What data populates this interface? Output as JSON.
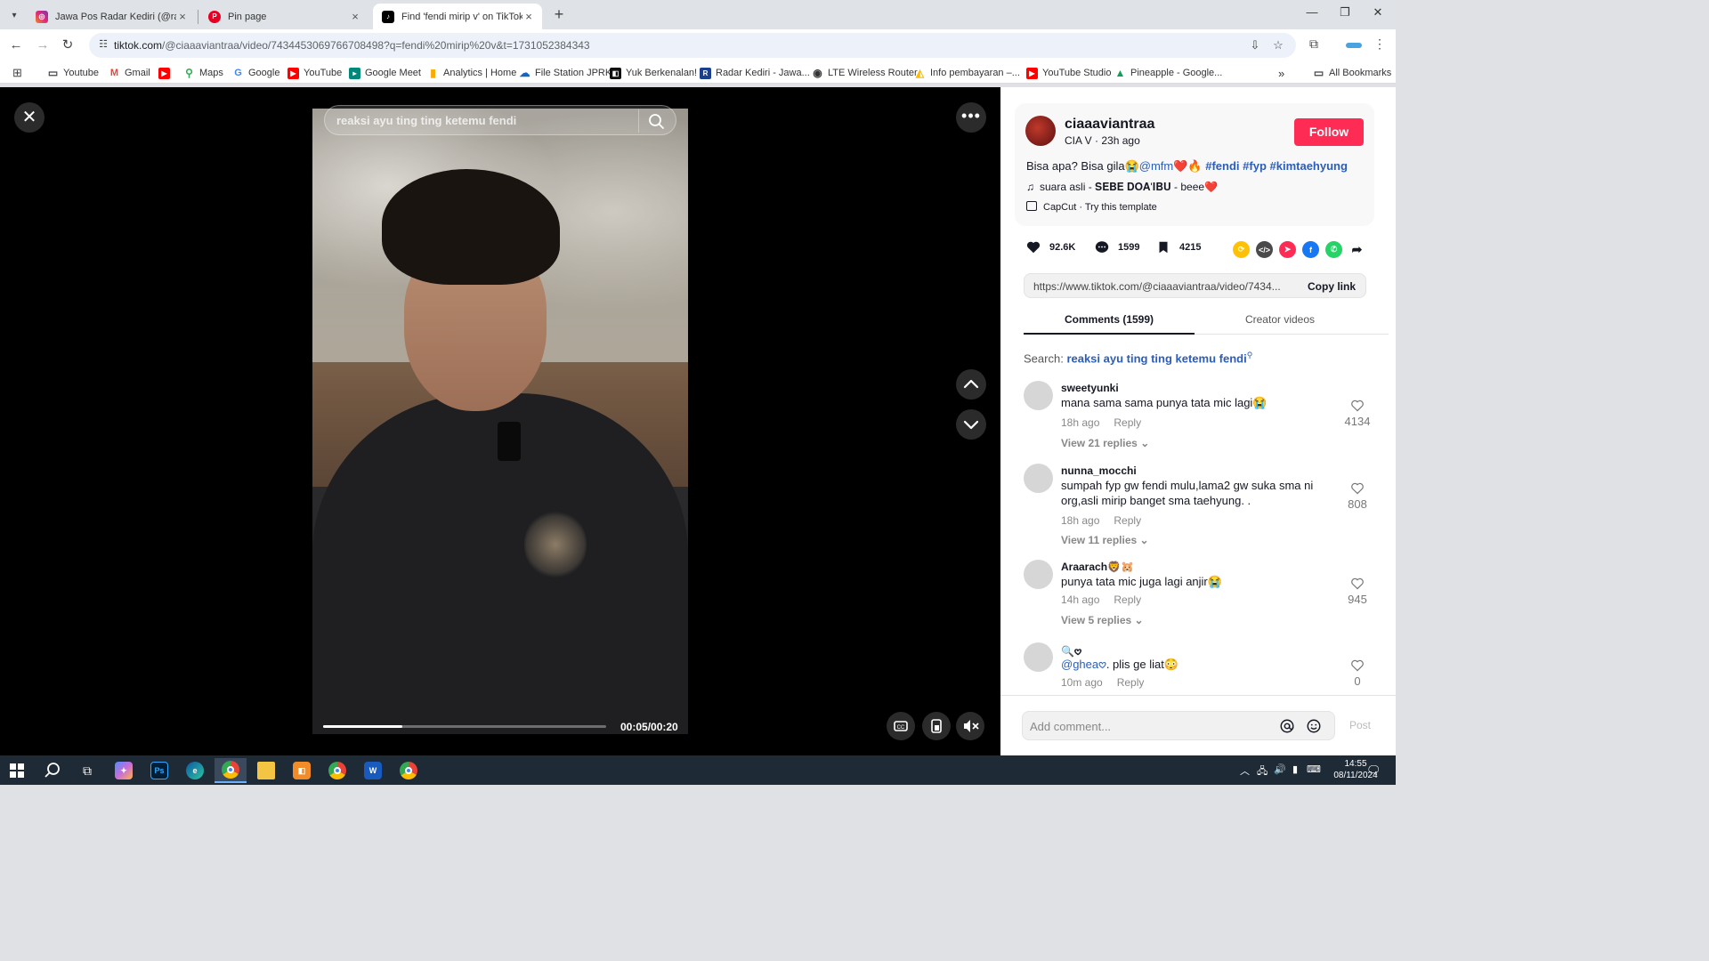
{
  "browser": {
    "tabs": [
      {
        "title": "Jawa Pos Radar Kediri (@radarkediri)",
        "icon": "instagram-icon",
        "color": "#d6249f"
      },
      {
        "title": "Pin page",
        "icon": "pinterest-icon",
        "color": "#e60023"
      },
      {
        "title": "Find 'fendi mirip v' on TikTok | TikTok",
        "icon": "tiktok-icon",
        "color": "#000000"
      }
    ],
    "url_host": "tiktok.com",
    "url_rest": "/@ciaaaviantraa/video/7434453069766708498?q=fendi%20mirip%20v&t=1731052384343",
    "bookmarks": [
      {
        "label": "Youtube",
        "icon": "folder-icon"
      },
      {
        "label": "Gmail",
        "icon": "gmail-icon"
      },
      {
        "label": "",
        "icon": "youtube-icon"
      },
      {
        "label": "Maps",
        "icon": "maps-icon"
      },
      {
        "label": "Google",
        "icon": "google-icon"
      },
      {
        "label": "YouTube",
        "icon": "youtube-icon"
      },
      {
        "label": "Google Meet",
        "icon": "meet-icon"
      },
      {
        "label": "Analytics | Home",
        "icon": "analytics-icon"
      },
      {
        "label": "File Station JPRK",
        "icon": "filestation-icon"
      },
      {
        "label": "Yuk Berkenalan!",
        "icon": "app-icon"
      },
      {
        "label": "Radar Kediri - Jawa...",
        "icon": "bookmark-icon"
      },
      {
        "label": "LTE Wireless Router",
        "icon": "globe-icon"
      },
      {
        "label": "Info pembayaran –...",
        "icon": "googleads-icon"
      },
      {
        "label": "YouTube Studio",
        "icon": "youtube-icon"
      },
      {
        "label": "Pineapple - Google...",
        "icon": "drive-icon"
      }
    ],
    "all_bookmarks": "All Bookmarks"
  },
  "video": {
    "search_query": "reaksi ayu ting ting ketemu fendi",
    "timecode": "00:05/00:20",
    "progress": 0.28
  },
  "post": {
    "username": "ciaaaviantraa",
    "display_name": "CIA V",
    "time_ago": "23h ago",
    "follow_label": "Follow",
    "caption_text": "Bisa apa? Bisa gila😭",
    "caption_mention": "@mfm",
    "caption_emoji": "❤️🔥",
    "hashtags": [
      "#fendi",
      "#fyp",
      "#kimtaehyung"
    ],
    "music": "suara asli - 𝐒𝐄𝐁𝐄 𝐃𝐎𝐀'𝐈𝐁𝐔 - beee❤️",
    "capcut": "CapCut · Try this template",
    "likes": "92.6K",
    "comments": "1599",
    "saves": "4215",
    "link": "https://www.tiktok.com/@ciaaaviantraa/video/7434...",
    "copy_label": "Copy link"
  },
  "panel": {
    "tab_comments": "Comments (1599)",
    "tab_creator": "Creator videos",
    "search_label": "Search:",
    "search_query": "reaksi ayu ting ting ketemu fendi",
    "comment_placeholder": "Add comment...",
    "post_label": "Post"
  },
  "comments": [
    {
      "user": "sweetyunki",
      "text": "mana sama sama punya tata mic lagi😭",
      "time": "18h ago",
      "reply": "Reply",
      "likes": "4134",
      "replies": "View 21 replies"
    },
    {
      "user": "nunna_mocchi",
      "text": "sumpah fyp gw fendi mulu,lama2 gw suka sma ni org,asli mirip banget sma taehyung. .",
      "time": "18h ago",
      "reply": "Reply",
      "likes": "808",
      "replies": "View 11 replies"
    },
    {
      "user": "Araarach🦁🐹",
      "text": "punya tata mic juga lagi anjir😭",
      "time": "14h ago",
      "reply": "Reply",
      "likes": "945",
      "replies": "View 5 replies"
    },
    {
      "user": "🔍𖹭",
      "mention": "@ghea𖹭",
      "text": ". plis ge liat😳",
      "time": "10m ago",
      "reply": "Reply",
      "likes": "0"
    }
  ],
  "taskbar": {
    "time": "14:55",
    "date": "08/11/2024"
  },
  "colors": {
    "follow": "#fe2c55",
    "hashtag": "#2b5db9",
    "taskbar": "#1f2a37"
  }
}
